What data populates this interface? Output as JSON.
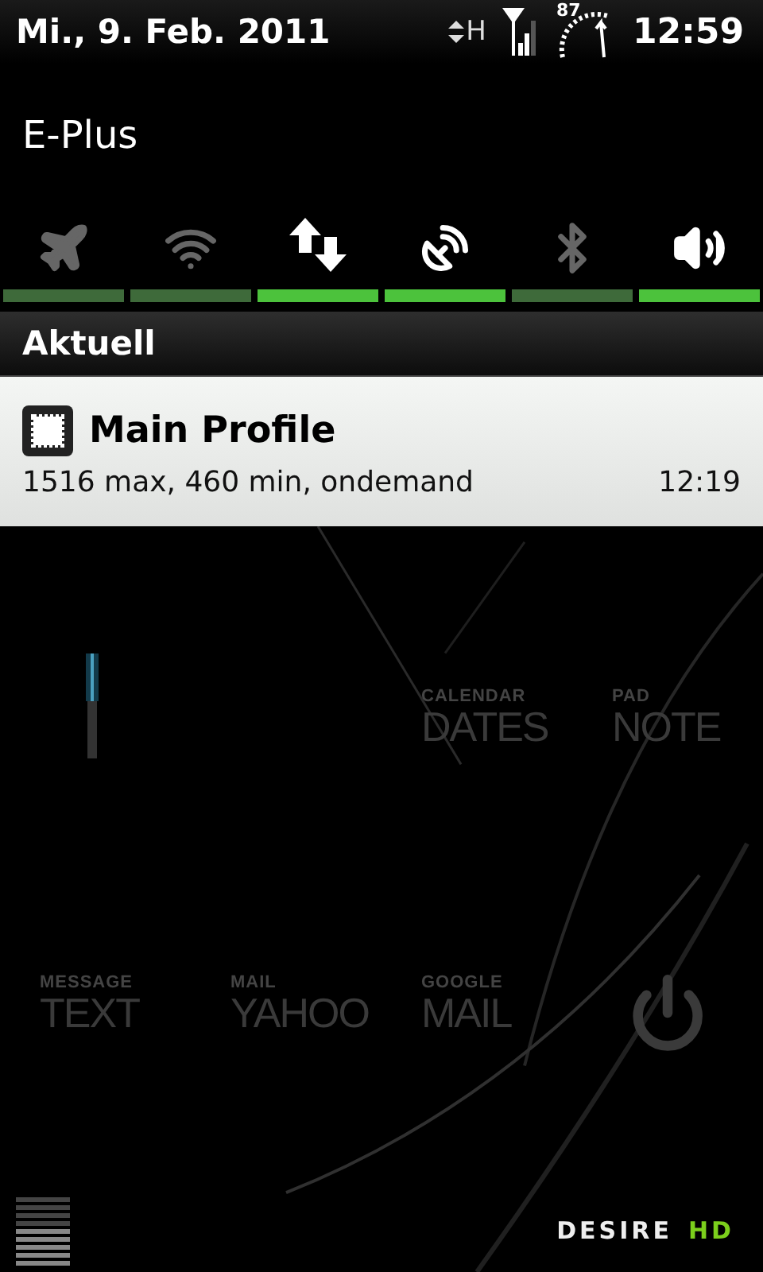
{
  "status_bar": {
    "date": "Mi., 9. Feb. 2011",
    "network_type": "H",
    "battery": "87",
    "time": "12:59"
  },
  "carrier": "E-Plus",
  "toggles": [
    {
      "kind": "airplane",
      "on": false
    },
    {
      "kind": "wifi",
      "on": false
    },
    {
      "kind": "data",
      "on": true
    },
    {
      "kind": "gps",
      "on": true
    },
    {
      "kind": "bluetooth",
      "on": false
    },
    {
      "kind": "sound",
      "on": true
    }
  ],
  "section_title": "Aktuell",
  "notifications": [
    {
      "title": "Main Profile",
      "detail": "1516 max, 460 min, ondemand",
      "time": "12:19"
    }
  ],
  "home_rows": [
    {
      "widgets": [
        {
          "caption": "CALENDAR",
          "label": "DATES"
        },
        {
          "caption": "PAD",
          "label": "NOTE"
        }
      ]
    },
    {
      "widgets": [
        {
          "caption": "MESSAGE",
          "label": "TEXT"
        },
        {
          "caption": "MAIL",
          "label": "YAHOO"
        },
        {
          "caption": "GOOGLE",
          "label": "MAIL"
        }
      ]
    }
  ],
  "logo": {
    "brand": "DESIRE",
    "model": "HD"
  }
}
